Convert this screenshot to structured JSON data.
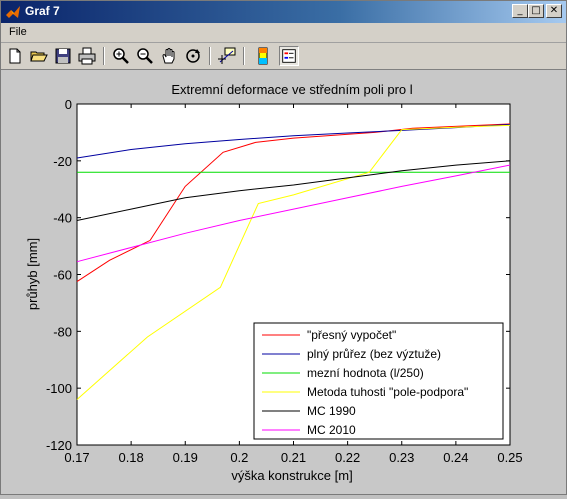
{
  "window": {
    "title": "Graf 7",
    "minimize_label": "_",
    "maximize_label": "□",
    "close_label": "✕"
  },
  "menu": {
    "file_label": "File"
  },
  "toolbar": {
    "buttons": [
      "new-file",
      "open-folder",
      "save",
      "print",
      "zoom-in",
      "zoom-out",
      "pan",
      "rotate",
      "data-cursor",
      "colorbar",
      "legend"
    ]
  },
  "chart_data": {
    "type": "line",
    "title": "Extremní deformace ve středním poli pro l",
    "xlabel": "výška konstrukce [m]",
    "ylabel": "průhyb [mm]",
    "xlim": [
      0.17,
      0.25
    ],
    "ylim": [
      -120,
      0
    ],
    "xticks": [
      "0.17",
      "0.18",
      "0.19",
      "0.2",
      "0.21",
      "0.22",
      "0.23",
      "0.24",
      "0.25"
    ],
    "yticks": [
      "0",
      "-20",
      "-40",
      "-60",
      "-80",
      "-100",
      "-120"
    ],
    "grid": false,
    "legend_position": "bottom-right",
    "series": [
      {
        "name": "\"přesný vypočet\"",
        "color": "#ff0000",
        "points": [
          [
            0.17,
            -62.5
          ],
          [
            0.176,
            -55
          ],
          [
            0.1835,
            -48
          ],
          [
            0.19,
            -29
          ],
          [
            0.197,
            -17
          ],
          [
            0.203,
            -13.5
          ],
          [
            0.21,
            -12
          ],
          [
            0.225,
            -10
          ],
          [
            0.232,
            -8.5
          ],
          [
            0.25,
            -7
          ]
        ]
      },
      {
        "name": "plný průřez (bez výztuže)",
        "color": "#0000a0",
        "points": [
          [
            0.17,
            -19
          ],
          [
            0.18,
            -16
          ],
          [
            0.19,
            -14
          ],
          [
            0.2,
            -12.5
          ],
          [
            0.21,
            -11.2
          ],
          [
            0.22,
            -10.2
          ],
          [
            0.23,
            -9.3
          ],
          [
            0.24,
            -8.3
          ],
          [
            0.25,
            -7.2
          ]
        ]
      },
      {
        "name": "mezní hodnota (l/250)",
        "color": "#00dd00",
        "points": [
          [
            0.17,
            -24
          ],
          [
            0.25,
            -24
          ]
        ]
      },
      {
        "name": "Metoda tuhosti \"pole-podpora\"",
        "color": "#ffff00",
        "points": [
          [
            0.17,
            -104
          ],
          [
            0.183,
            -82
          ],
          [
            0.1965,
            -64.5
          ],
          [
            0.2035,
            -35
          ],
          [
            0.21,
            -32
          ],
          [
            0.224,
            -24
          ],
          [
            0.23,
            -9
          ],
          [
            0.24,
            -8.2
          ],
          [
            0.25,
            -7.5
          ]
        ]
      },
      {
        "name": "MC 1990",
        "color": "#000000",
        "points": [
          [
            0.17,
            -41
          ],
          [
            0.18,
            -37
          ],
          [
            0.19,
            -33
          ],
          [
            0.2,
            -30.5
          ],
          [
            0.21,
            -28.5
          ],
          [
            0.22,
            -26
          ],
          [
            0.23,
            -23.5
          ],
          [
            0.24,
            -21.5
          ],
          [
            0.25,
            -20
          ]
        ]
      },
      {
        "name": "MC 2010",
        "color": "#ff00ff",
        "points": [
          [
            0.17,
            -55.5
          ],
          [
            0.18,
            -50.5
          ],
          [
            0.19,
            -45.5
          ],
          [
            0.2,
            -41
          ],
          [
            0.21,
            -37
          ],
          [
            0.22,
            -33
          ],
          [
            0.23,
            -29
          ],
          [
            0.24,
            -25.3
          ],
          [
            0.25,
            -21.5
          ]
        ]
      }
    ]
  }
}
